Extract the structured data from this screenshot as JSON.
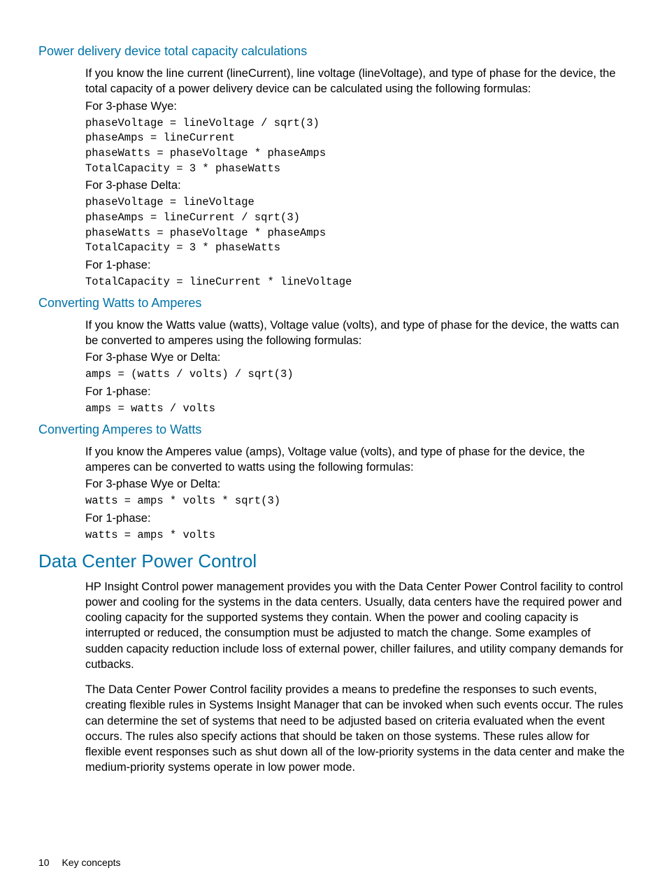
{
  "section1": {
    "title": "Power delivery device total capacity calculations",
    "intro": "If you know the line current (lineCurrent), line voltage (lineVoltage), and type of phase for the device, the total capacity of a power delivery device can be calculated using the following formulas:",
    "wye_label": "For 3-phase Wye:",
    "wye_code": "phaseVoltage = lineVoltage / sqrt(3)\nphaseAmps = lineCurrent\nphaseWatts = phaseVoltage * phaseAmps\nTotalCapacity = 3 * phaseWatts",
    "delta_label": "For 3-phase Delta:",
    "delta_code": "phaseVoltage = lineVoltage\nphaseAmps = lineCurrent / sqrt(3)\nphaseWatts = phaseVoltage * phaseAmps\nTotalCapacity = 3 * phaseWatts",
    "one_label": "For 1-phase:",
    "one_code": "TotalCapacity = lineCurrent * lineVoltage"
  },
  "section2": {
    "title": "Converting Watts to Amperes",
    "intro": "If you know the Watts value (watts), Voltage value (volts), and type of phase for the device, the watts can be converted to amperes using the following formulas:",
    "three_label": "For 3-phase Wye or Delta:",
    "three_code": "amps = (watts / volts) / sqrt(3)",
    "one_label": "For 1-phase:",
    "one_code": "amps = watts / volts"
  },
  "section3": {
    "title": "Converting Amperes to Watts",
    "intro": "If you know the Amperes value (amps), Voltage value (volts), and type of phase for the device, the amperes can be converted to watts using the following formulas:",
    "three_label": "For 3-phase Wye or Delta:",
    "three_code": "watts = amps * volts * sqrt(3)",
    "one_label": "For 1-phase:",
    "one_code": "watts = amps * volts"
  },
  "section4": {
    "title": "Data Center Power Control",
    "para1": "HP Insight Control power management provides you with the Data Center Power Control facility to control power and cooling for the systems in the data centers. Usually, data centers have the required power and cooling capacity for the supported systems they contain. When the power and cooling capacity is interrupted or reduced, the consumption must be adjusted to match the change. Some examples of sudden capacity reduction include loss of external power, chiller failures, and utility company demands for cutbacks.",
    "para2": "The Data Center Power Control facility provides a means to predefine the responses to such events, creating flexible rules in Systems Insight Manager that can be invoked when such events occur. The rules can determine the set of systems that need to be adjusted based on criteria evaluated when the event occurs. The rules also specify actions that should be taken on those systems. These rules allow for flexible event responses such as shut down all of the low-priority systems in the data center and make the medium-priority systems operate in low power mode."
  },
  "footer": {
    "page": "10",
    "label": "Key concepts"
  }
}
